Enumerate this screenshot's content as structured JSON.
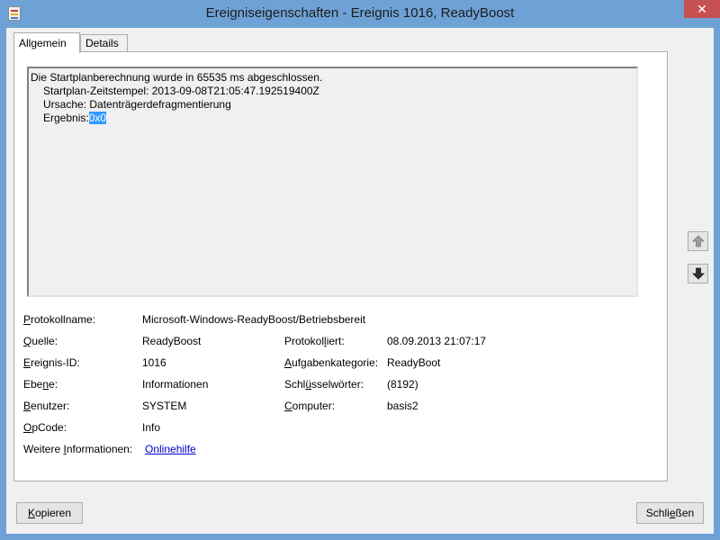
{
  "window": {
    "title": "Ereigniseigenschaften - Ereignis 1016, ReadyBoost",
    "close_glyph": "✕",
    "icon": "event-viewer-icon"
  },
  "tabs": [
    {
      "label": "Allgemein",
      "active": true
    },
    {
      "label": "Details",
      "active": false
    }
  ],
  "description": {
    "line1": "Die Startplanberechnung wurde in 65535 ms abgeschlossen.",
    "line2": "Startplan-Zeitstempel: 2013-09-08T21:05:47.192519400Z",
    "line3": "Ursache: Datenträgerdefragmentierung",
    "line4_label": "Ergebnis:",
    "line4_value": "0x0"
  },
  "fields": {
    "protokollname": {
      "label": "Protokollname:",
      "value": "Microsoft-Windows-ReadyBoost/Betriebsbereit"
    },
    "quelle": {
      "label": "Quelle:",
      "value": "ReadyBoost"
    },
    "protokolliert": {
      "label": "Protokolliert:",
      "value": "08.09.2013 21:07:17"
    },
    "ereignis_id": {
      "label": "Ereignis-ID:",
      "value": "1016"
    },
    "aufgabenkategorie": {
      "label": "Aufgabenkategorie:",
      "value": "ReadyBoot"
    },
    "ebene": {
      "label": "Ebene:",
      "value": "Informationen"
    },
    "schluesselwoerter": {
      "label": "Schlüsselwörter:",
      "value": "(8192)"
    },
    "benutzer": {
      "label": "Benutzer:",
      "value": "SYSTEM"
    },
    "computer": {
      "label": "Computer:",
      "value": "basis2"
    },
    "opcode": {
      "label": "OpCode:",
      "value": "Info"
    },
    "weitere": {
      "label": "Weitere Informationen:",
      "value": "Onlinehilfe"
    }
  },
  "labels_parts": {
    "protokollname": [
      "P",
      "rotokollname:"
    ],
    "quelle": [
      "Q",
      "uelle:"
    ],
    "protokolliert": [
      "Protokol",
      "l",
      "iert:"
    ],
    "ereignis_id": [
      "E",
      "reignis-ID:"
    ],
    "aufgabenkategorie": [
      "A",
      "ufgabenkategorie:"
    ],
    "ebene": [
      "Ebe",
      "n",
      "e:"
    ],
    "schluesselwoerter": [
      "Schl",
      "ü",
      "sselwörter:"
    ],
    "benutzer": [
      "B",
      "enutzer:"
    ],
    "computer": [
      "C",
      "omputer:"
    ],
    "opcode": [
      "O",
      "pCode:"
    ],
    "weitere": [
      "Weitere ",
      "I",
      "nformationen:"
    ]
  },
  "buttons": {
    "kopieren": [
      "K",
      "opieren"
    ],
    "schliessen": [
      "Schli",
      "e",
      "ßen"
    ]
  },
  "nav": {
    "up_icon": "arrow-up-icon",
    "down_icon": "arrow-down-icon"
  }
}
